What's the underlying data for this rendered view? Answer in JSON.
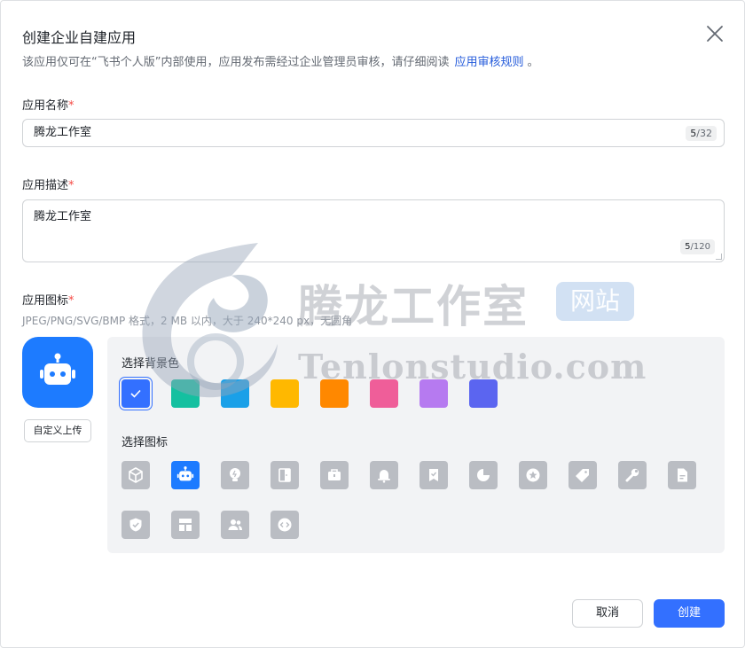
{
  "dialog": {
    "title": "创建企业自建应用",
    "subtitle": "该应用仅可在“飞书个人版”内部使用，应用发布需经过企业管理员审核，请仔细阅读",
    "subtitle_link": "应用审核规则",
    "subtitle_end": "。"
  },
  "name_field": {
    "label": "应用名称",
    "required_mark": "*",
    "value": "腾龙工作室",
    "count": "5",
    "max": "/32"
  },
  "desc_field": {
    "label": "应用描述",
    "required_mark": "*",
    "value": "腾龙工作室",
    "count": "5",
    "max": "/120"
  },
  "icon_field": {
    "label": "应用图标",
    "required_mark": "*",
    "hint": "JPEG/PNG/SVG/BMP 格式，2 MB 以内，大于 240*240 px，无圆角",
    "upload_label": "自定义上传",
    "bg_section_label": "选择背景色",
    "icon_section_label": "选择图标",
    "selected_bg_index": 0,
    "selected_icon_index": 1,
    "bg_colors": [
      "#3370ff",
      "#14c0a0",
      "#1aa0e8",
      "#ffb800",
      "#ff8800",
      "#ef5e99",
      "#b67af0",
      "#5b65f0"
    ],
    "icons": [
      "cube-icon",
      "robot-icon",
      "bulb-icon",
      "door-icon",
      "briefcase-icon",
      "bell-icon",
      "bookmark-check-icon",
      "pie-chart-icon",
      "star-badge-icon",
      "tag-icon",
      "wrench-icon",
      "document-icon",
      "shield-check-icon",
      "layout-icon",
      "people-icon",
      "code-icon"
    ]
  },
  "watermark": {
    "cn": "腾龙工作室",
    "badge": "网站",
    "en": "Tenlonstudio.com"
  },
  "footer": {
    "cancel_label": "取消",
    "create_label": "创建"
  },
  "colors": {
    "accent": "#3370ff",
    "link": "#245bdb",
    "required": "#f54a45",
    "icon_gray": "#babdc3",
    "app_icon_bg": "#1d7bff"
  }
}
